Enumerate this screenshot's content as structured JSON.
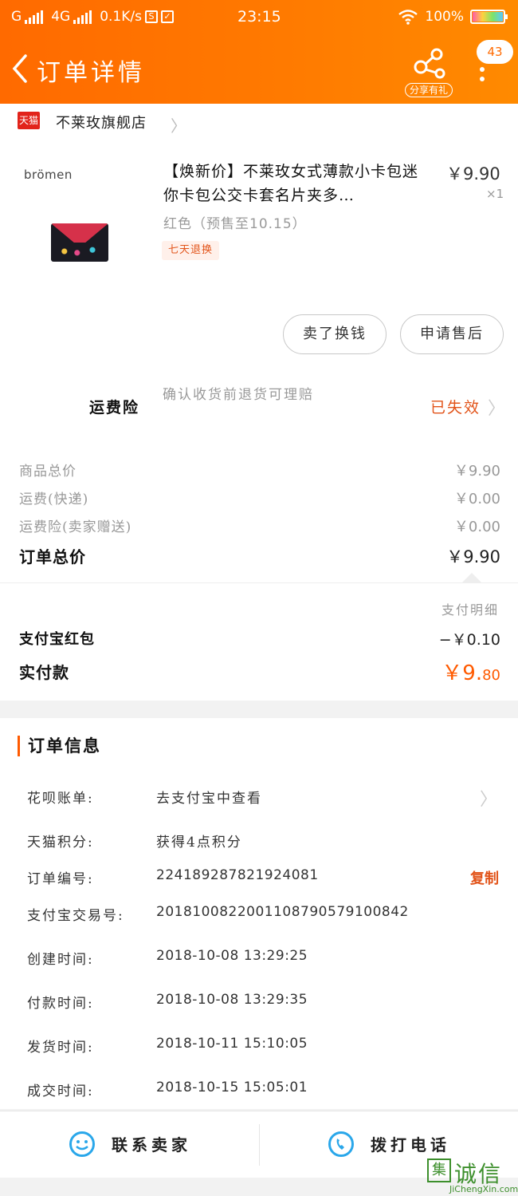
{
  "status_bar": {
    "carrier1": "G",
    "carrier2": "4G",
    "speed": "0.1K/s",
    "s_icon": "S",
    "time": "23:15",
    "battery": "100%"
  },
  "nav": {
    "title": "订单详情",
    "share_label": "分享有礼",
    "badge_count": "43"
  },
  "shop": {
    "badge": "天猫",
    "name": "不莱玫旗舰店"
  },
  "product": {
    "brand": "brömen",
    "title": "【焕新价】不莱玫女式薄款小卡包迷你卡包公交卡套名片夹多…",
    "price": "￥9.90",
    "qty": "×1",
    "sku": "红色（预售至10.15）",
    "tag": "七天退换"
  },
  "actions": {
    "sell_label": "卖了换钱",
    "aftersale_label": "申请售后"
  },
  "insurance": {
    "label": "运费险",
    "desc": "确认收货前退货可理赔",
    "status": "已失效"
  },
  "summary": [
    {
      "label": "商品总价",
      "value": "￥9.90"
    },
    {
      "label": "运费(快递)",
      "value": "￥0.00"
    },
    {
      "label": "运费险(卖家赠送)",
      "value": "￥0.00"
    }
  ],
  "total": {
    "label": "订单总价",
    "value": "￥9.90"
  },
  "payment": {
    "detail_link": "支付明细",
    "redpacket_label": "支付宝红包",
    "redpacket_value": "−￥0.10",
    "paid_label": "实付款",
    "paid_value_main": "￥9.",
    "paid_value_cents": "80"
  },
  "order_info": {
    "heading": "订单信息",
    "huabei_label": "花呗账单:",
    "huabei_value": "去支付宝中查看",
    "points_label": "天猫积分:",
    "points_value": "获得4点积分",
    "order_no_label": "订单编号:",
    "order_no_value": "224189287821924081",
    "copy_label": "复制",
    "alipay_no_label": "支付宝交易号:",
    "alipay_no_value": "2018100822001108790579100842",
    "created_label": "创建时间:",
    "created_value": "2018-10-08 13:29:25",
    "paid_label": "付款时间:",
    "paid_value": "2018-10-08 13:29:35",
    "shipped_label": "发货时间:",
    "shipped_value": "2018-10-11 15:10:05",
    "done_label": "成交时间:",
    "done_value": "2018-10-15 15:05:01"
  },
  "bottom_bar": {
    "contact_label": "联系卖家",
    "call_label": "拨打电话"
  },
  "watermark": {
    "box": "集",
    "big": "诚信",
    "small": "JiChengXin.com"
  },
  "colors": {
    "brand_orange": "#ff6a00",
    "accent_red": "#e2541a",
    "icon_blue": "#2aa7ea"
  }
}
